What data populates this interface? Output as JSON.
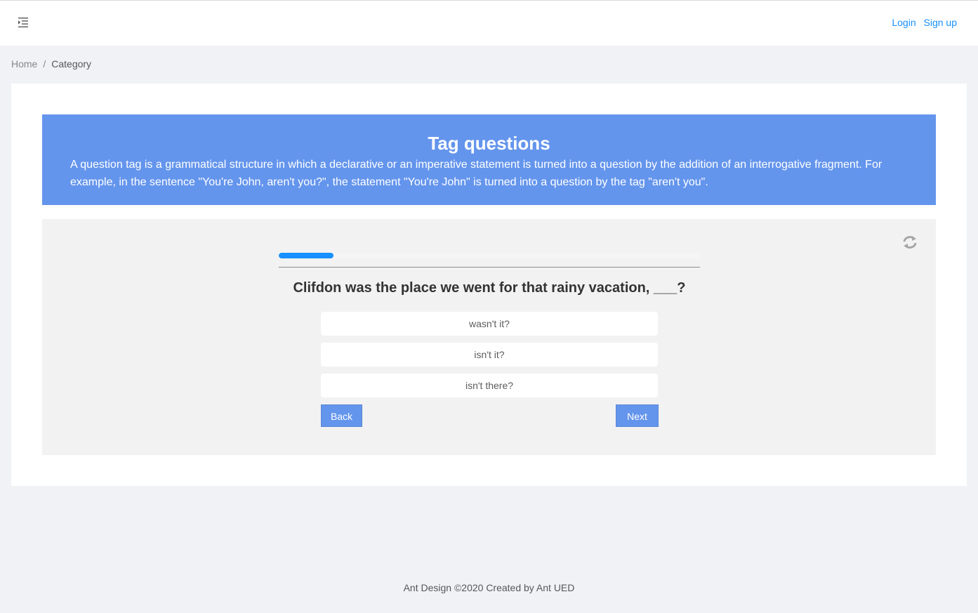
{
  "header": {
    "menu_icon": "menu-unfold-icon",
    "login_label": "Login",
    "signup_label": "Sign up"
  },
  "breadcrumb": {
    "home": "Home",
    "separator": "/",
    "current": "Category"
  },
  "banner": {
    "title": "Tag questions",
    "description": "A question tag is a grammatical structure in which a declarative or an imperative statement is turned into a question by the addition of an interrogative fragment. For example, in the sentence \"You're John, aren't you?\", the statement \"You're John\" is turned into a question by the tag \"aren't you\".",
    "background_color": "#6495ed"
  },
  "quiz": {
    "progress_fraction": 0.13,
    "refresh_icon": "refresh-icon",
    "question": "Clifdon was the place we went for that rainy vacation, ___?",
    "options": [
      "wasn't it?",
      "isn't it?",
      "isn't there?"
    ],
    "back_label": "Back",
    "next_label": "Next",
    "accent_color": "#1890ff"
  },
  "footer": {
    "text": "Ant Design ©2020 Created by Ant UED"
  }
}
